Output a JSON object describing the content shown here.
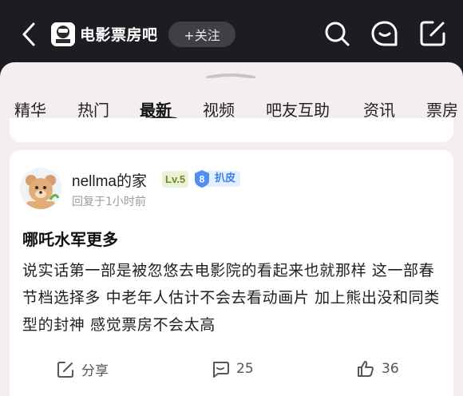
{
  "header": {
    "forum_name": "电影票房吧",
    "follow_label": "+关注",
    "icons": [
      "back-icon",
      "search-icon",
      "message-icon",
      "edit-icon"
    ]
  },
  "tabs": [
    {
      "label": "精华",
      "active": false
    },
    {
      "label": "热门",
      "active": false
    },
    {
      "label": "最新",
      "active": true
    },
    {
      "label": "视频",
      "active": false
    },
    {
      "label": "吧友互助",
      "active": false
    },
    {
      "label": "资讯",
      "active": false
    },
    {
      "label": "票房",
      "active": false
    }
  ],
  "post": {
    "username": "nellma的家",
    "level": "Lv.5",
    "fan_level": "8",
    "fan_title": "扒皮",
    "reply_time": "回复于1小时前",
    "title": "哪吒水军更多",
    "body": "说实话第一部是被忽悠去电影院的看起来也就那样 这一部春节档选择多 中老年人估计不会去看动画片 加上熊出没和同类型的封神 感觉票房不会太高",
    "actions": {
      "share_label": "分享",
      "comment_count": "25",
      "like_count": "36"
    }
  },
  "colors": {
    "header_bg": "#1c1d22",
    "sheet_bg": "#f4eef0",
    "level_badge_text": "#6f8d1f",
    "fan_badge_blue": "#3a7fe8"
  }
}
